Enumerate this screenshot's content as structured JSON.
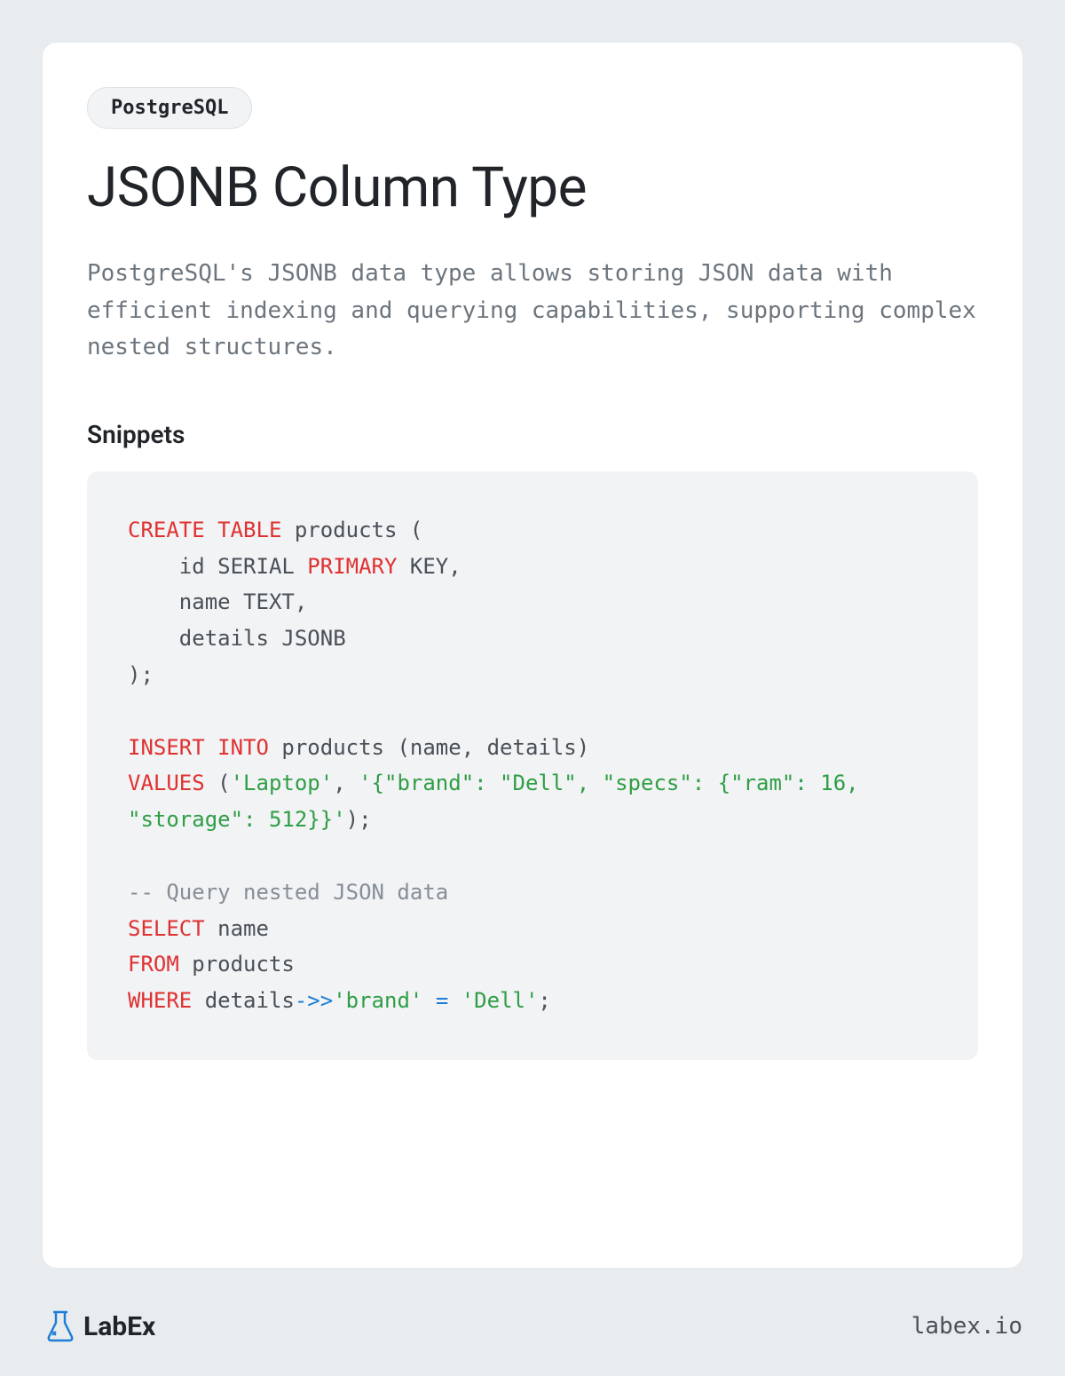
{
  "tag": "PostgreSQL",
  "title": "JSONB Column Type",
  "description": "PostgreSQL's JSONB data type allows storing JSON data with efficient indexing and querying capabilities, supporting complex nested structures.",
  "section_title": "Snippets",
  "code": {
    "tokens": [
      {
        "t": "CREATE",
        "c": "kw"
      },
      {
        "t": " ",
        "c": ""
      },
      {
        "t": "TABLE",
        "c": "kw"
      },
      {
        "t": " products (\n    id SERIAL ",
        "c": ""
      },
      {
        "t": "PRIMARY",
        "c": "kw"
      },
      {
        "t": " KEY,\n    name TEXT,\n    details JSONB\n);\n\n",
        "c": ""
      },
      {
        "t": "INSERT",
        "c": "kw"
      },
      {
        "t": " ",
        "c": ""
      },
      {
        "t": "INTO",
        "c": "kw"
      },
      {
        "t": " products (name, details)\n",
        "c": ""
      },
      {
        "t": "VALUES",
        "c": "kw"
      },
      {
        "t": " (",
        "c": ""
      },
      {
        "t": "'Laptop'",
        "c": "str"
      },
      {
        "t": ", ",
        "c": ""
      },
      {
        "t": "'{\"brand\": \"Dell\", \"specs\": {\"ram\": 16, \"storage\": 512}}'",
        "c": "str"
      },
      {
        "t": ");\n\n",
        "c": ""
      },
      {
        "t": "-- Query nested JSON data",
        "c": "comment"
      },
      {
        "t": "\n",
        "c": ""
      },
      {
        "t": "SELECT",
        "c": "kw"
      },
      {
        "t": " name\n",
        "c": ""
      },
      {
        "t": "FROM",
        "c": "kw"
      },
      {
        "t": " products\n",
        "c": ""
      },
      {
        "t": "WHERE",
        "c": "kw"
      },
      {
        "t": " details",
        "c": ""
      },
      {
        "t": "->>",
        "c": "op"
      },
      {
        "t": "'brand'",
        "c": "str"
      },
      {
        "t": " ",
        "c": ""
      },
      {
        "t": "=",
        "c": "op"
      },
      {
        "t": " ",
        "c": ""
      },
      {
        "t": "'Dell'",
        "c": "str"
      },
      {
        "t": ";",
        "c": ""
      }
    ]
  },
  "logo_text": "LabEx",
  "site_url": "labex.io"
}
